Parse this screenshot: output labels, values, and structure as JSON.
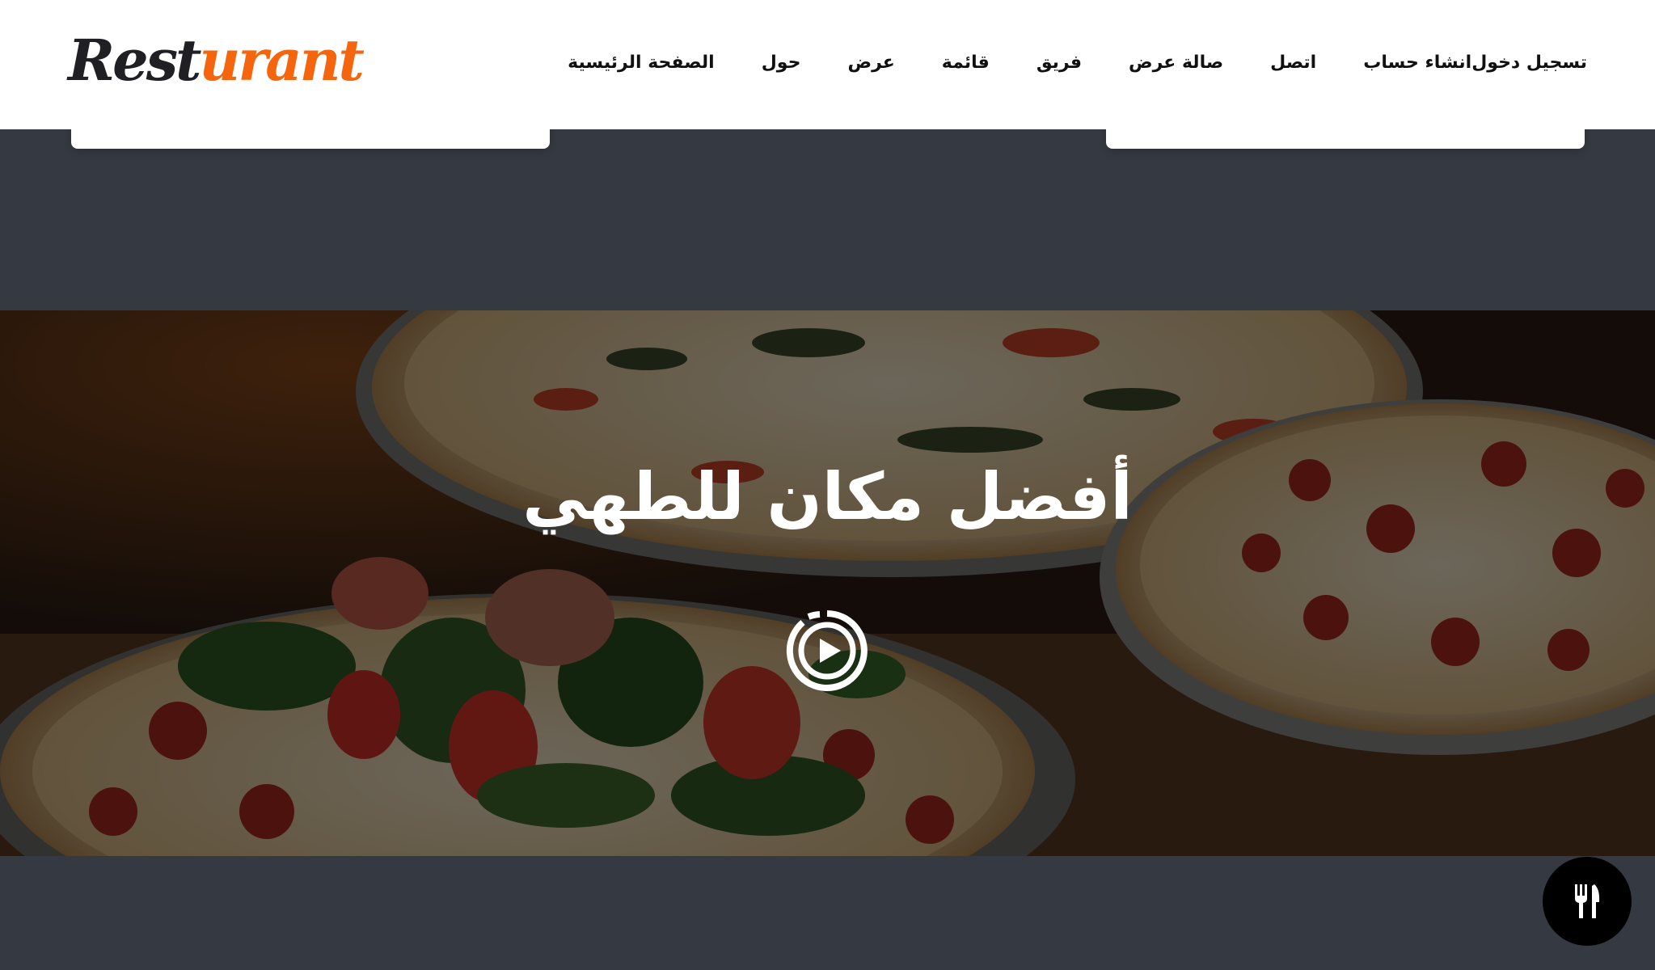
{
  "header": {
    "logo_part1": "Rest",
    "logo_part2": "urant",
    "nav": [
      {
        "label": "تسجيل دخول"
      },
      {
        "label": "انشاء حساب"
      },
      {
        "label": "اتصل"
      },
      {
        "label": "صالة عرض"
      },
      {
        "label": "فريق"
      },
      {
        "label": "قائمة"
      },
      {
        "label": "عرض"
      },
      {
        "label": "حول"
      },
      {
        "label": "الصفحة الرئيسية"
      }
    ]
  },
  "hero": {
    "title": "أفضل مكان للطهي",
    "play_icon": "play-circle-icon",
    "background_image": "pizza-photo"
  },
  "floating_button": {
    "icon": "fork-knife-icon"
  },
  "colors": {
    "accent": "#f4650e",
    "logo_dark": "#1f1f24",
    "page_bg": "#353a42",
    "header_bg": "#ffffff",
    "fab_bg": "#000000"
  }
}
